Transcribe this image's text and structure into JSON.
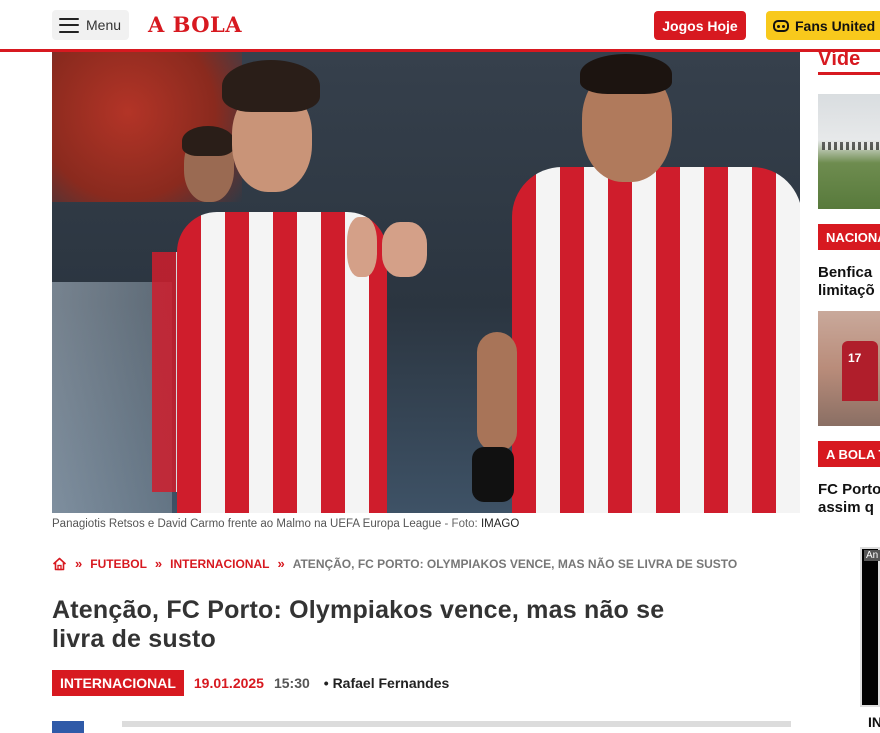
{
  "header": {
    "menu_label": "Menu",
    "logo_text": "A BOLA",
    "jogos_label": "Jogos Hoje",
    "fans_label": "Fans United"
  },
  "hero": {
    "caption": "Panagiotis Retsos e David Carmo frente ao Malmo na UEFA Europa League",
    "photo_prefix": "Foto:",
    "photo_credit": "IMAGO"
  },
  "breadcrumb": {
    "items": [
      "FUTEBOL",
      "INTERNACIONAL"
    ],
    "current": "ATENÇÃO, FC PORTO: OLYMPIAKOS VENCE, MAS NÃO SE LIVRA DE SUSTO"
  },
  "article": {
    "title": "Atenção, FC Porto: Olympiakos vence, mas não se livra de susto",
    "tag": "INTERNACIONAL",
    "date": "19.01.2025",
    "time": "15:30",
    "author": "• Rafael Fernandes"
  },
  "sidebar": {
    "heading": "Víde",
    "tag1": "NACIONA",
    "text1_line1": "Benfica",
    "text1_line2": "limitaçõ",
    "tag2": "A BOLA T",
    "text2_line1": "FC Porto",
    "text2_line2": "assim q",
    "ad_label": "An",
    "bottom_text": "IN"
  },
  "colors": {
    "brand_red": "#d71920",
    "fans_yellow": "#f8c91c"
  }
}
